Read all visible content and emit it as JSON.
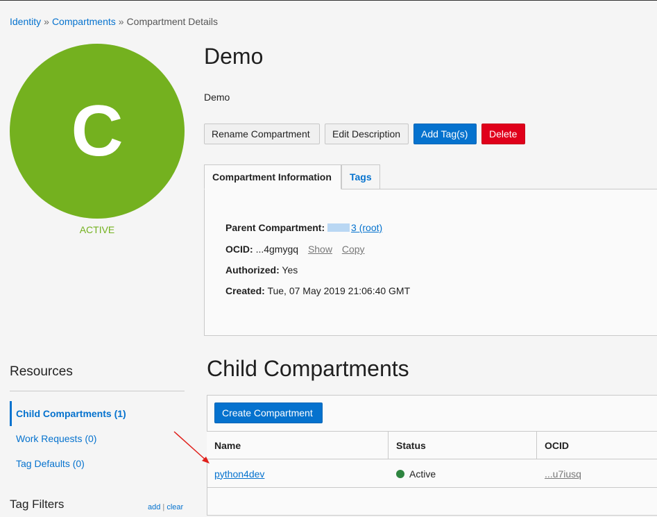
{
  "breadcrumb": {
    "items": [
      "Identity",
      "Compartments",
      "Compartment Details"
    ],
    "separator": "»"
  },
  "avatar": {
    "letter": "C",
    "color": "#74b11f"
  },
  "status": {
    "label": "ACTIVE",
    "color": "#74b11f"
  },
  "compartment": {
    "name": "Demo",
    "description": "Demo"
  },
  "actions": {
    "rename": "Rename Compartment",
    "edit_description": "Edit Description",
    "add_tags": "Add Tag(s)",
    "delete": "Delete"
  },
  "tabs": {
    "info": "Compartment Information",
    "tags": "Tags"
  },
  "info": {
    "parent_label": "Parent Compartment:",
    "parent_value": "3 (root)",
    "ocid_label": "OCID:",
    "ocid_value": "...4gmygq",
    "ocid_show": "Show",
    "ocid_copy": "Copy",
    "authorized_label": "Authorized:",
    "authorized_value": "Yes",
    "created_label": "Created:",
    "created_value": "Tue, 07 May 2019 21:06:40 GMT"
  },
  "resources": {
    "heading": "Resources",
    "items": [
      {
        "label": "Child Compartments (1)",
        "active": true
      },
      {
        "label": "Work Requests (0)",
        "active": false
      },
      {
        "label": "Tag Defaults (0)",
        "active": false
      }
    ]
  },
  "tag_filters": {
    "heading": "Tag Filters",
    "add": "add",
    "sep": "|",
    "clear": "clear"
  },
  "child_compartments": {
    "heading": "Child Compartments",
    "create_button": "Create Compartment",
    "columns": [
      "Name",
      "Status",
      "OCID"
    ],
    "rows": [
      {
        "name": "python4dev",
        "status": "Active",
        "ocid": "...u7iusq"
      }
    ]
  },
  "colors": {
    "link": "#0572ce",
    "primary": "#0572ce",
    "danger": "#e0001b",
    "status_active": "#2e8540",
    "annotation_arrow": "#e0201b"
  }
}
